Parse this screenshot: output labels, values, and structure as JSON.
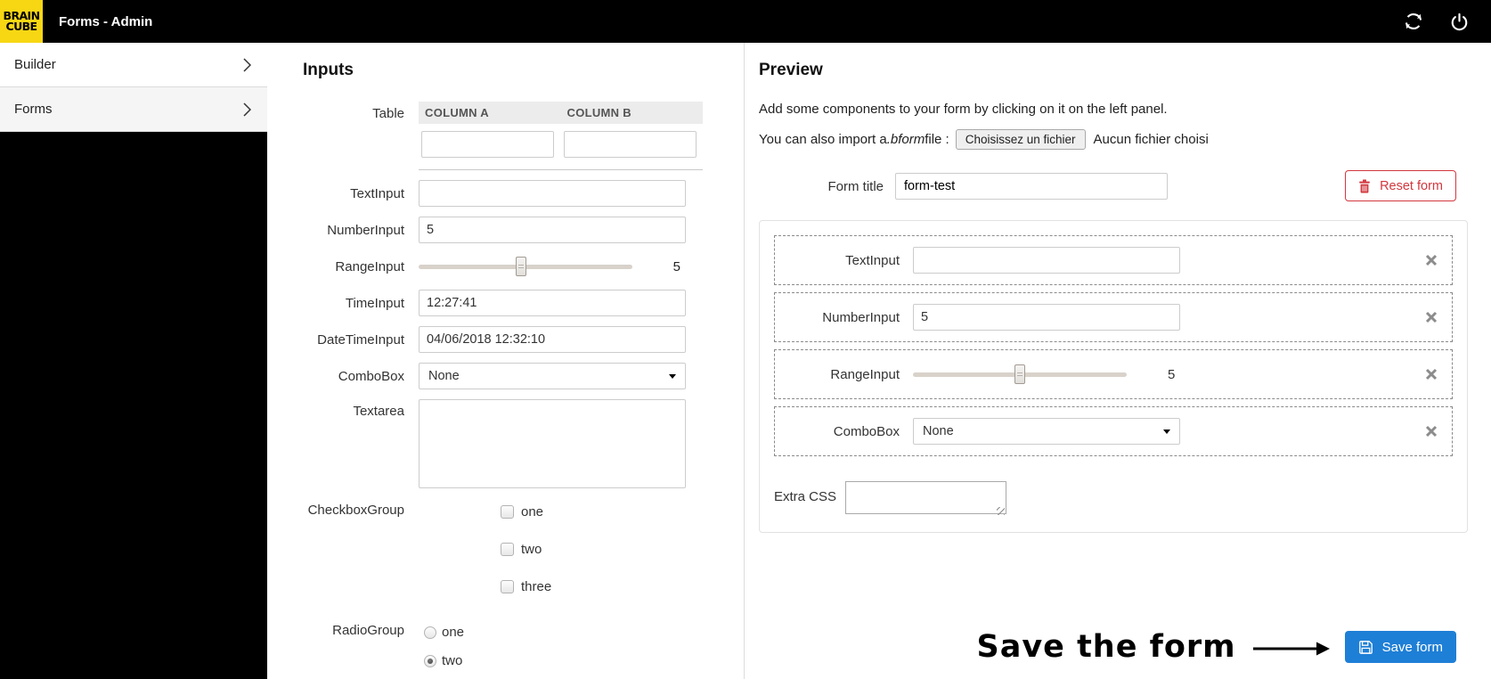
{
  "colors": {
    "topbar_bg": "#000000",
    "logo_yellow": "#f7d714",
    "accent_blue": "#1e7fd6",
    "danger_red": "#d2383f"
  },
  "topbar": {
    "logo": {
      "line1": "BRAIN",
      "line2": "CUBE"
    },
    "title": "Forms - Admin",
    "icons": {
      "refresh": "refresh-icon",
      "power": "power-icon"
    }
  },
  "sidebar": {
    "items": [
      {
        "label": "Builder"
      },
      {
        "label": "Forms"
      }
    ]
  },
  "inputs_panel": {
    "title": "Inputs",
    "table": {
      "label": "Table",
      "columns": [
        "COLUMN A",
        "COLUMN B"
      ],
      "cells": [
        "",
        ""
      ]
    },
    "fields": [
      {
        "label": "TextInput",
        "type": "text",
        "value": ""
      },
      {
        "label": "NumberInput",
        "type": "text",
        "value": "5"
      },
      {
        "label": "RangeInput",
        "type": "range",
        "value": "5",
        "percent": 48
      },
      {
        "label": "TimeInput",
        "type": "text",
        "value": "12:27:41"
      },
      {
        "label": "DateTimeInput",
        "type": "text",
        "value": "04/06/2018 12:32:10"
      },
      {
        "label": "ComboBox",
        "type": "select",
        "value": "None"
      },
      {
        "label": "Textarea",
        "type": "textarea",
        "value": ""
      },
      {
        "label": "CheckboxGroup",
        "type": "checkboxgroup",
        "options": [
          {
            "label": "one",
            "checked": false
          },
          {
            "label": "two",
            "checked": false
          },
          {
            "label": "three",
            "checked": false
          }
        ]
      },
      {
        "label": "RadioGroup",
        "type": "radiogroup",
        "options": [
          {
            "label": "one",
            "selected": false
          },
          {
            "label": "two",
            "selected": true
          }
        ]
      }
    ]
  },
  "preview_panel": {
    "title": "Preview",
    "hint": "Add some components to your form by clicking on it on the left panel.",
    "import_prefix": "You can also import a ",
    "import_ext": ".bform",
    "import_suffix": " file :",
    "file_button": "Choisissez un fichier",
    "file_status": "Aucun fichier choisi",
    "form_title_label": "Form title",
    "form_title_value": "form-test",
    "reset_button": "Reset form",
    "components": [
      {
        "label": "TextInput",
        "type": "text",
        "value": ""
      },
      {
        "label": "NumberInput",
        "type": "text",
        "value": "5"
      },
      {
        "label": "RangeInput",
        "type": "range",
        "value": "5",
        "percent": 50
      },
      {
        "label": "ComboBox",
        "type": "select",
        "value": "None"
      }
    ],
    "extra_css_label": "Extra CSS",
    "extra_css_value": "",
    "annotation": "Save the form",
    "save_button": "Save form"
  }
}
